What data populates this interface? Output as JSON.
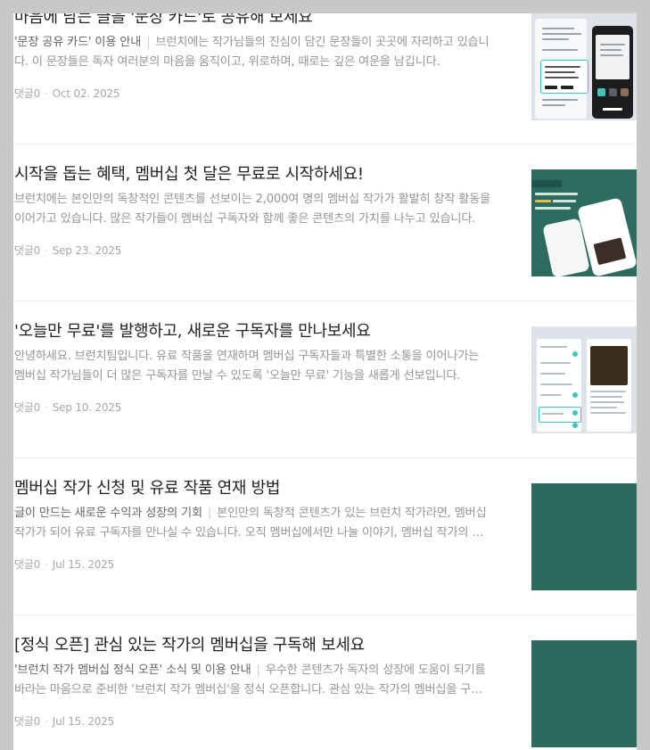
{
  "posts": [
    {
      "title": "마음에 남는 글을 '문장 카드'로 공유해 보세요",
      "subtitle": "'문장 공유 카드' 이용 안내",
      "excerpt": "브런치에는 작가님들의 진심이 담긴 문장들이 곳곳에 자리하고 있습니다. 이 문장들은 독자 여러분의 마음을 움직이고, 위로하며, 때로는 깊은 여운을 남깁니다.",
      "comments": "댓글0",
      "date": "Oct 02. 2025",
      "thumb": "sentence-card-ui"
    },
    {
      "title": "시작을 돕는 혜택, 멤버십 첫 달은 무료로 시작하세요!",
      "subtitle": "",
      "excerpt": "브런치에는 본인만의 독창적인 콘텐츠를 선보이는 2,000여 명의 멤버십 작가가 활발히 창작 활동을 이어가고 있습니다. 많은 작가들이 멤버십 구독자와 함께 좋은 콘텐츠의 가치를 나누고 있습니다.",
      "comments": "댓글0",
      "date": "Sep 23. 2025",
      "thumb": "membership-promo"
    },
    {
      "title": "'오늘만 무료'를 발행하고, 새로운 구독자를 만나보세요",
      "subtitle": "",
      "excerpt": "안녕하세요. 브런치팀입니다. 유료 작품을 연재하며 멤버십 구독자들과 특별한 소통을 이어나가는 멤버십 작가님들이 더 많은 구독자를 만날 수 있도록 '오늘만 무료' 기능을 새롭게 선보입니다.",
      "comments": "댓글0",
      "date": "Sep 10. 2025",
      "thumb": "free-today-settings"
    },
    {
      "title": "멤버십 작가 신청 및 유료 작품 연재 방법",
      "subtitle": "글이 만드는 새로운 수익과 성장의 기회",
      "excerpt": "본인만의 독창적 콘텐츠가 있는 브런치 작가라면, 멤버십 작가가 되어 유료 구독자를 만나실 수 있습니다. 오직 멤버십에서만 나눌 이야기, 멤버십 작가의 특별한 콘텐츠를 연재해 보세요.",
      "comments": "댓글0",
      "date": "Jul 15. 2025",
      "thumb": "green-cover"
    },
    {
      "title": "[정식 오픈] 관심 있는 작가의 멤버십을 구독해 보세요",
      "subtitle": "'브런치 작가 멤버십 정식 오픈' 소식 및 이용 안내",
      "excerpt": "우수한 콘텐츠가 독자의 성장에 도움이 되기를 바라는 마음으로 준비한 '브런치 작가 멤버십'을 정식 오픈합니다. 관심 있는 작가의 멤버십을 구독하고 특별한 콘텐츠를 만나보세요.",
      "comments": "댓글0",
      "date": "Jul 15. 2025",
      "thumb": "green-cover"
    }
  ],
  "colors": {
    "page_bg": "#c8c8c8",
    "card_bg": "#ffffff",
    "title": "#222222",
    "excerpt": "#959595",
    "subtitle": "#666666",
    "meta": "#a8a8a8",
    "thumb_green": "#2d6a5d",
    "thumb_blue_grey": "#dde3e8",
    "accent_teal": "#3dc7b8"
  }
}
